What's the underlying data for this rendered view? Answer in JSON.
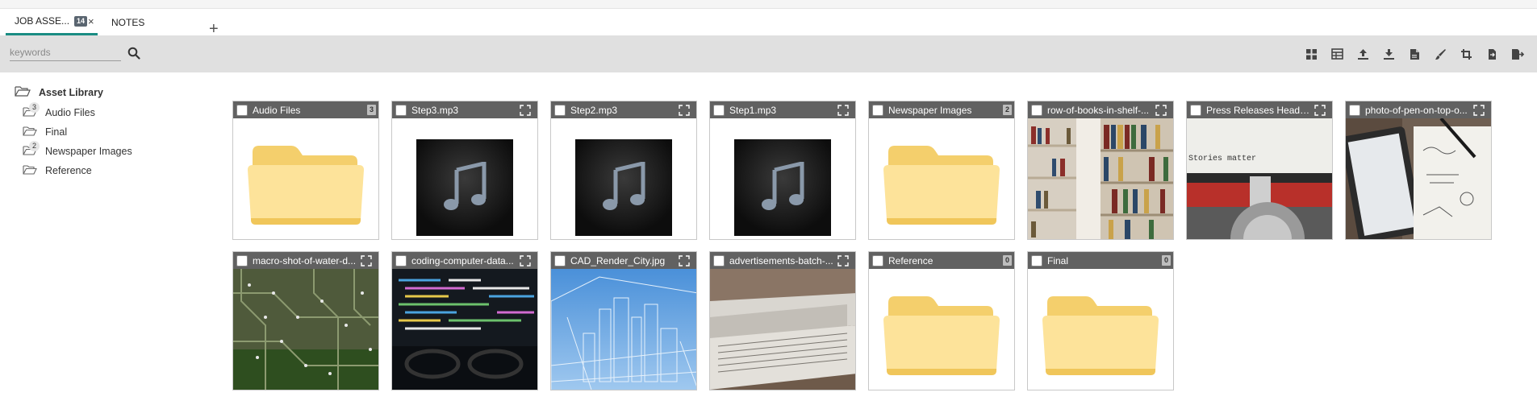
{
  "tabs": [
    {
      "label": "JOB ASSE...",
      "badge": "14",
      "active": true
    },
    {
      "label": "NOTES",
      "active": false
    }
  ],
  "add_tab_label": "+",
  "close_glyph": "×",
  "search": {
    "placeholder": "keywords",
    "value": ""
  },
  "toolbar_icons": [
    "grid-view-icon",
    "table-view-icon",
    "upload-icon",
    "download-icon",
    "file-icon",
    "brush-icon",
    "crop-icon",
    "export-icon",
    "logout-icon"
  ],
  "sidebar": {
    "root": "Asset Library",
    "items": [
      {
        "label": "Audio Files",
        "count": "3"
      },
      {
        "label": "Final",
        "count": ""
      },
      {
        "label": "Newspaper Images",
        "count": "2"
      },
      {
        "label": "Reference",
        "count": ""
      }
    ]
  },
  "tiles": [
    {
      "name": "Audio Files",
      "kind": "folder",
      "count": "3"
    },
    {
      "name": "Step3.mp3",
      "kind": "audio"
    },
    {
      "name": "Step2.mp3",
      "kind": "audio"
    },
    {
      "name": "Step1.mp3",
      "kind": "audio"
    },
    {
      "name": "Newspaper Images",
      "kind": "folder",
      "count": "2"
    },
    {
      "name": "row-of-books-in-shelf-...",
      "kind": "image",
      "subject": "library bookshelves"
    },
    {
      "name": "Press Releases Heade...",
      "kind": "image",
      "subject": "typewriter",
      "overlay_text": "Stories matter"
    },
    {
      "name": "photo-of-pen-on-top-o...",
      "kind": "image",
      "subject": "tablet and notebook"
    },
    {
      "name": "macro-shot-of-water-d...",
      "kind": "image",
      "subject": "circuit board"
    },
    {
      "name": "coding-computer-data...",
      "kind": "image",
      "subject": "code on screen"
    },
    {
      "name": "CAD_Render_City.jpg",
      "kind": "image",
      "subject": "city wireframe"
    },
    {
      "name": "advertisements-batch-...",
      "kind": "image",
      "subject": "newspapers"
    },
    {
      "name": "Reference",
      "kind": "folder",
      "count": "0"
    },
    {
      "name": "Final",
      "kind": "folder",
      "count": "0"
    }
  ],
  "colors": {
    "accent": "#1a8c83",
    "toolbar_bg": "#e0e0e0",
    "tile_header": "#616161"
  }
}
